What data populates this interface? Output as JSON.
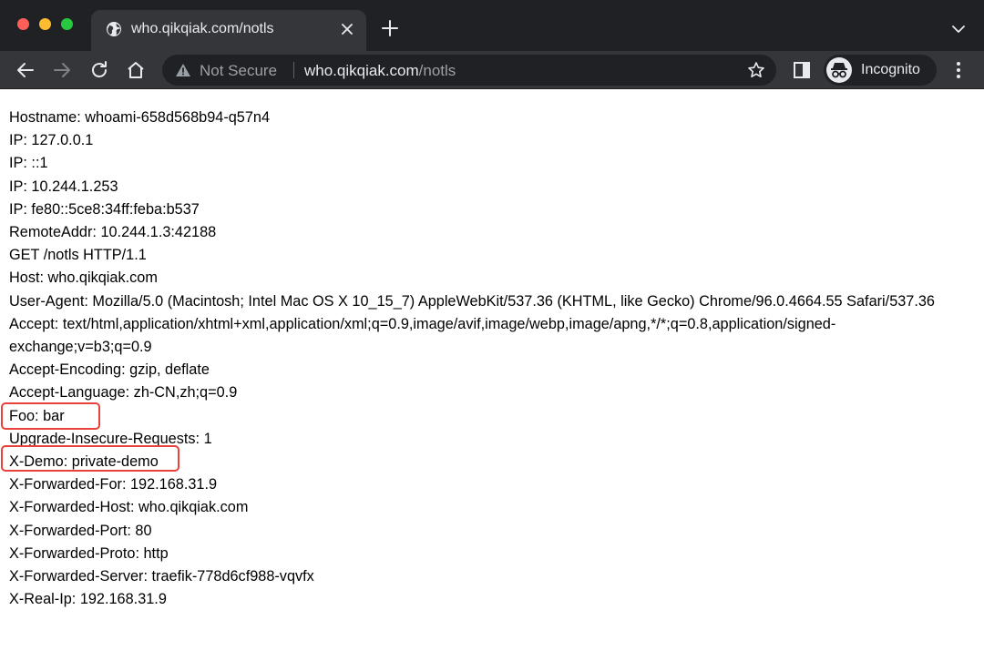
{
  "browser": {
    "tab": {
      "title": "who.qikqiak.com/notls"
    },
    "omnibox": {
      "security_label": "Not Secure",
      "url_host": "who.qikqiak.com",
      "url_path": "/notls"
    },
    "profile": {
      "label": "Incognito"
    },
    "icons": {
      "favicon": "globe-icon",
      "tab_close": "close-icon",
      "new_tab": "plus-icon",
      "tab_search": "chevron-down-icon",
      "back": "back-arrow-icon",
      "forward": "forward-arrow-icon",
      "reload": "reload-icon",
      "home": "home-icon",
      "security": "warning-icon",
      "bookmark": "star-icon",
      "side_panel": "side-panel-icon",
      "profile": "incognito-icon",
      "menu": "more-vert-icon"
    },
    "colors": {
      "tabstrip": "#202124",
      "toolbar": "#35363a",
      "highlight": "#e8403a",
      "close": "#ff5f57",
      "minimize": "#febc2e",
      "maximize": "#28c840"
    }
  },
  "page": {
    "lines": [
      "Hostname: whoami-658d568b94-q57n4",
      "IP: 127.0.0.1",
      "IP: ::1",
      "IP: 10.244.1.253",
      "IP: fe80::5ce8:34ff:feba:b537",
      "RemoteAddr: 10.244.1.3:42188",
      "GET /notls HTTP/1.1",
      "Host: who.qikqiak.com",
      "User-Agent: Mozilla/5.0 (Macintosh; Intel Mac OS X 10_15_7) AppleWebKit/537.36 (KHTML, like Gecko) Chrome/96.0.4664.55 Safari/537.36",
      "Accept: text/html,application/xhtml+xml,application/xml;q=0.9,image/avif,image/webp,image/apng,*/*;q=0.8,application/signed-exchange;v=b3;q=0.9",
      "Accept-Encoding: gzip, deflate",
      "Accept-Language: zh-CN,zh;q=0.9",
      "Foo: bar",
      "Upgrade-Insecure-Requests: 1",
      "X-Demo: private-demo",
      "X-Forwarded-For: 192.168.31.9",
      "X-Forwarded-Host: who.qikqiak.com",
      "X-Forwarded-Port: 80",
      "X-Forwarded-Proto: http",
      "X-Forwarded-Server: traefik-778d6cf988-vqvfx",
      "X-Real-Ip: 192.168.31.9"
    ]
  }
}
